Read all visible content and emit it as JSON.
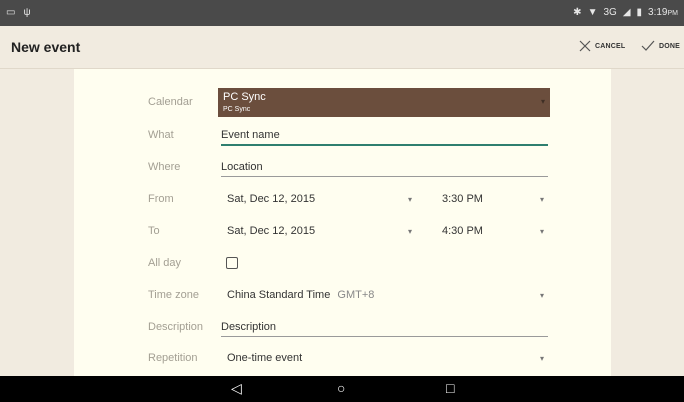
{
  "statusbar": {
    "network": "3G",
    "time": "3:19",
    "ampm": "PM"
  },
  "toolbar": {
    "title": "New event",
    "cancel_label": "CANCEL",
    "done_label": "DONE"
  },
  "form": {
    "calendar": {
      "label": "Calendar",
      "value": "PC Sync",
      "sub": "PC Sync"
    },
    "what": {
      "label": "What",
      "placeholder": "Event name"
    },
    "where": {
      "label": "Where",
      "placeholder": "Location"
    },
    "from": {
      "label": "From",
      "date": "Sat, Dec 12, 2015",
      "time": "3:30 PM"
    },
    "to": {
      "label": "To",
      "date": "Sat, Dec 12, 2015",
      "time": "4:30 PM"
    },
    "all_day": {
      "label": "All day"
    },
    "time_zone": {
      "label": "Time zone",
      "value": "China Standard Time",
      "offset": "GMT+8"
    },
    "description": {
      "label": "Description",
      "placeholder": "Description"
    },
    "repetition": {
      "label": "Repetition",
      "value": "One-time event"
    }
  },
  "colors": {
    "calendar_bg": "#6b4e3d",
    "accent": "#2f7f6f",
    "card_bg": "#fffef0",
    "page_bg": "#f1ebe0"
  },
  "icons": {
    "status_left": [
      "notification-icon",
      "usb-icon"
    ],
    "status_right": [
      "bluetooth-icon",
      "wifi-icon",
      "signal-icon",
      "battery-icon"
    ],
    "nav": [
      "back-icon",
      "home-icon",
      "recents-icon"
    ]
  }
}
